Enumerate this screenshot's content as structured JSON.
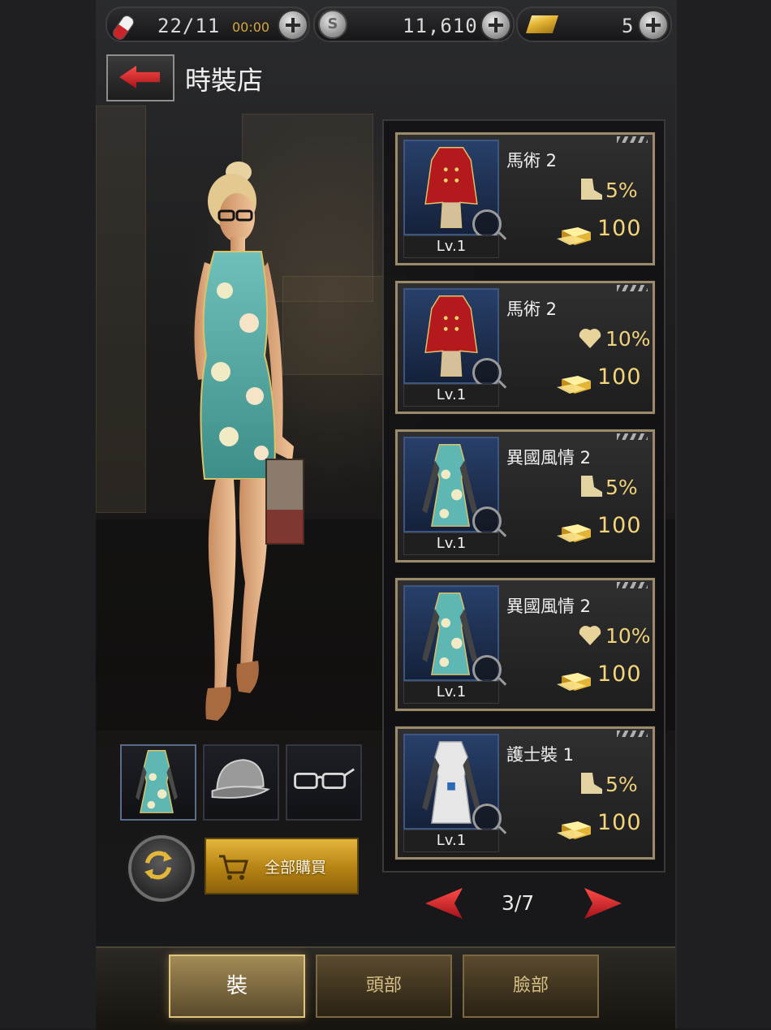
{
  "resources": {
    "stamina": {
      "value": "22/11",
      "timer": "00:00",
      "icon": "pill-icon"
    },
    "silver": {
      "value": "11,610",
      "icon": "silver-coin-icon"
    },
    "gold": {
      "value": "5",
      "icon": "gold-bar-icon"
    }
  },
  "header": {
    "title": "時裝店"
  },
  "slots": [
    {
      "name": "outfit",
      "icon": "dress-icon",
      "active": true
    },
    {
      "name": "head",
      "icon": "cap-icon",
      "active": false
    },
    {
      "name": "face",
      "icon": "glasses-icon",
      "active": false
    }
  ],
  "actions": {
    "buy_all_label": "全部購買"
  },
  "items": [
    {
      "name": "馬術 2",
      "level": "Lv.1",
      "stat_icon": "boot-icon",
      "stat": "5%",
      "price": "100",
      "outfit": "red-riding"
    },
    {
      "name": "馬術 2",
      "level": "Lv.1",
      "stat_icon": "heart-icon",
      "stat": "10%",
      "price": "100",
      "outfit": "red-riding"
    },
    {
      "name": "異國風情 2",
      "level": "Lv.1",
      "stat_icon": "boot-icon",
      "stat": "5%",
      "price": "100",
      "outfit": "qipao"
    },
    {
      "name": "異國風情 2",
      "level": "Lv.1",
      "stat_icon": "heart-icon",
      "stat": "10%",
      "price": "100",
      "outfit": "qipao"
    },
    {
      "name": "護士裝 1",
      "level": "Lv.1",
      "stat_icon": "boot-icon",
      "stat": "5%",
      "price": "100",
      "outfit": "nurse"
    }
  ],
  "pager": {
    "label": "3/7"
  },
  "tabs": [
    {
      "label": "裝",
      "active": true
    },
    {
      "label": "頭部",
      "active": false
    },
    {
      "label": "臉部",
      "active": false
    }
  ],
  "colors": {
    "accent_gold": "#e4b53c",
    "price_text": "#f4d57a",
    "arrow_red": "#e52a2a"
  }
}
